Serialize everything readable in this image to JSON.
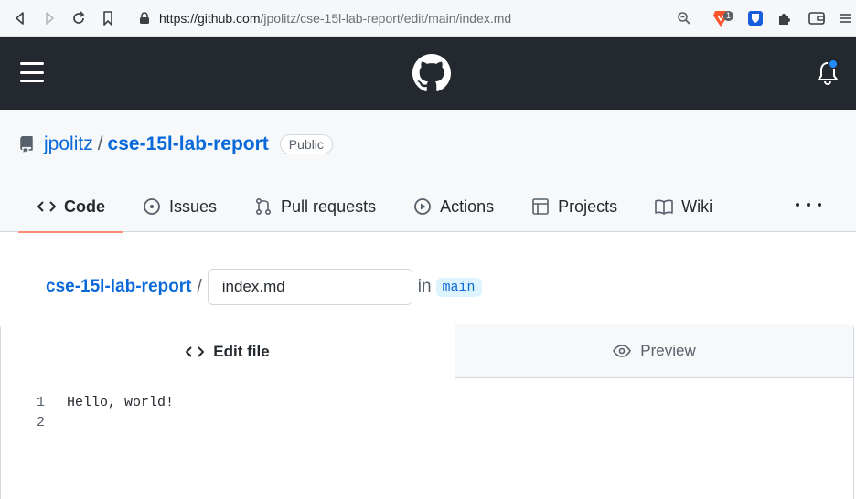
{
  "browser": {
    "url_host": "https://github.com",
    "url_path": "/jpolitz/cse-15l-lab-report/edit/main/index.md",
    "brave_badge": "1"
  },
  "repo": {
    "owner": "jpolitz",
    "separator": "/",
    "name": "cse-15l-lab-report",
    "visibility": "Public"
  },
  "tabs": [
    {
      "label": "Code",
      "icon": "code-icon",
      "active": true
    },
    {
      "label": "Issues",
      "icon": "issue-opened-icon"
    },
    {
      "label": "Pull requests",
      "icon": "git-pull-request-icon"
    },
    {
      "label": "Actions",
      "icon": "play-icon"
    },
    {
      "label": "Projects",
      "icon": "table-icon"
    },
    {
      "label": "Wiki",
      "icon": "book-icon"
    }
  ],
  "file": {
    "repo_link": "cse-15l-lab-report",
    "separator": "/",
    "filename": "index.md",
    "in_label": "in",
    "branch": "main"
  },
  "editor": {
    "edit_tab": "Edit file",
    "preview_tab": "Preview",
    "lines": [
      {
        "number": "1",
        "text": "Hello, world!"
      },
      {
        "number": "2",
        "text": ""
      }
    ]
  },
  "colors": {
    "header_bg": "#24292f",
    "link": "#0969da",
    "tab_underline": "#fd8c73",
    "notification_dot": "#218bff"
  }
}
